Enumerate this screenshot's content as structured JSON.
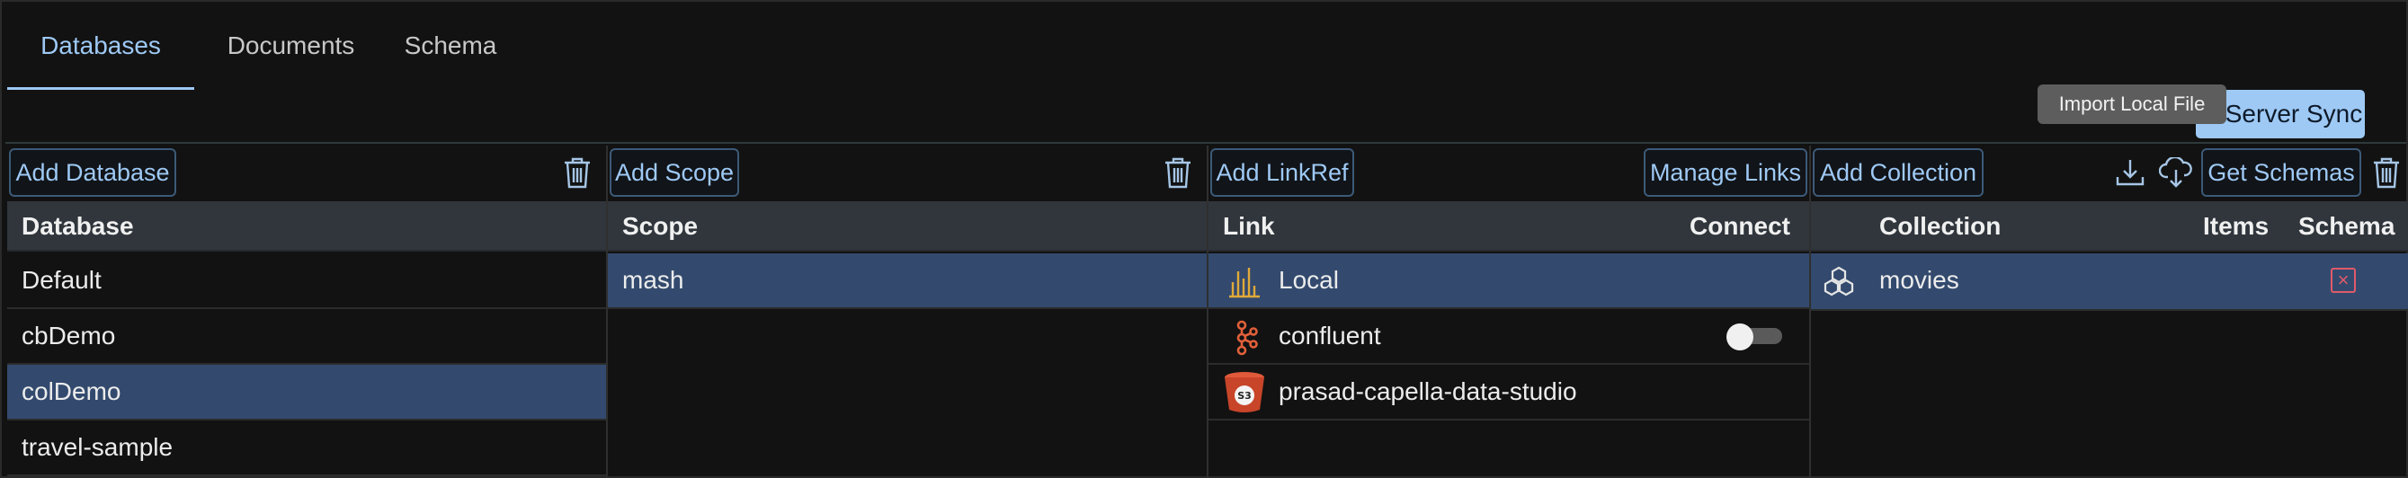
{
  "tabs": [
    {
      "label": "Databases",
      "active": true
    },
    {
      "label": "Documents",
      "active": false
    },
    {
      "label": "Schema",
      "active": false
    }
  ],
  "server_sync_label": "Server Sync",
  "tooltip_text": "Import Local File",
  "databases_panel": {
    "add_button": "Add Database",
    "header": "Database",
    "rows": [
      "Default",
      "cbDemo",
      "colDemo",
      "travel-sample"
    ],
    "selected": "colDemo"
  },
  "scopes_panel": {
    "add_button": "Add Scope",
    "header": "Scope",
    "rows": [
      "mash"
    ],
    "selected": "mash"
  },
  "links_panel": {
    "add_button": "Add LinkRef",
    "manage_button": "Manage Links",
    "header_link": "Link",
    "header_connect": "Connect",
    "rows": [
      {
        "name": "Local",
        "icon": "local-chart-icon"
      },
      {
        "name": "confluent",
        "icon": "kafka-icon",
        "connected": false
      },
      {
        "name": "prasad-capella-data-studio",
        "icon": "s3-bucket-icon"
      }
    ],
    "selected": "Local"
  },
  "collections_panel": {
    "add_button": "Add Collection",
    "get_schemas_button": "Get Schemas",
    "header_collection": "Collection",
    "header_items": "Items",
    "header_schema": "Schema",
    "rows": [
      {
        "name": "movies",
        "items": "",
        "schema": "none"
      }
    ]
  },
  "colors": {
    "accent": "#9ec9f5",
    "selected_row": "#334a6e",
    "header_bg": "#30363c",
    "background": "#121212"
  }
}
